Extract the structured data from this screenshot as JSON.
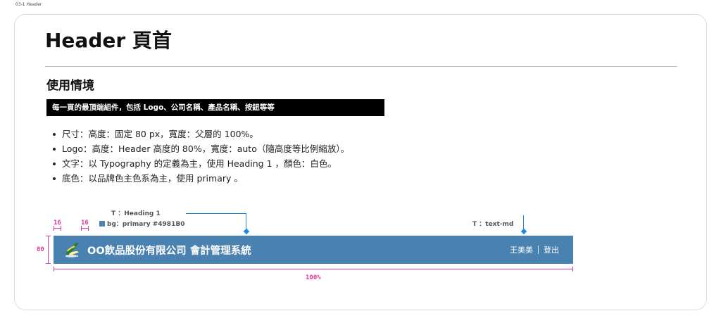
{
  "frame_label": "03-1 Header",
  "page_title": "Header 頁首",
  "section": {
    "title": "使用情境",
    "banner": "每一頁的最頂端組件，包括 Logo、公司名稱、產品名稱、按鈕等等",
    "bullets": [
      "尺寸：高度：固定 80 px，寬度：父層的 100%。",
      "Logo：高度：Header 高度的 80%，寬度：auto（隨高度等比例縮放）。",
      "文字：以 Typography 的定義為主，使用 Heading 1 ，顏色：白色。",
      "底色：以品牌色主色系為主，使用 primary 。"
    ]
  },
  "annotations": {
    "heading_spec": "T ：Heading 1",
    "bg_spec": "bg：primary #4981B0",
    "text_spec": "T ：text-md",
    "padding_left": "16",
    "padding_logo": "16",
    "height": "80",
    "width": "100%"
  },
  "header_demo": {
    "title": "OO飲品股份有限公司  會計管理系統",
    "user_name": "王美美",
    "logout": "登出"
  },
  "colors": {
    "primary": "#4981B0",
    "annotation_pink": "#e0359a",
    "annotation_blue": "#1e88e5"
  },
  "icons": {
    "logo": "drink-logo-icon"
  }
}
